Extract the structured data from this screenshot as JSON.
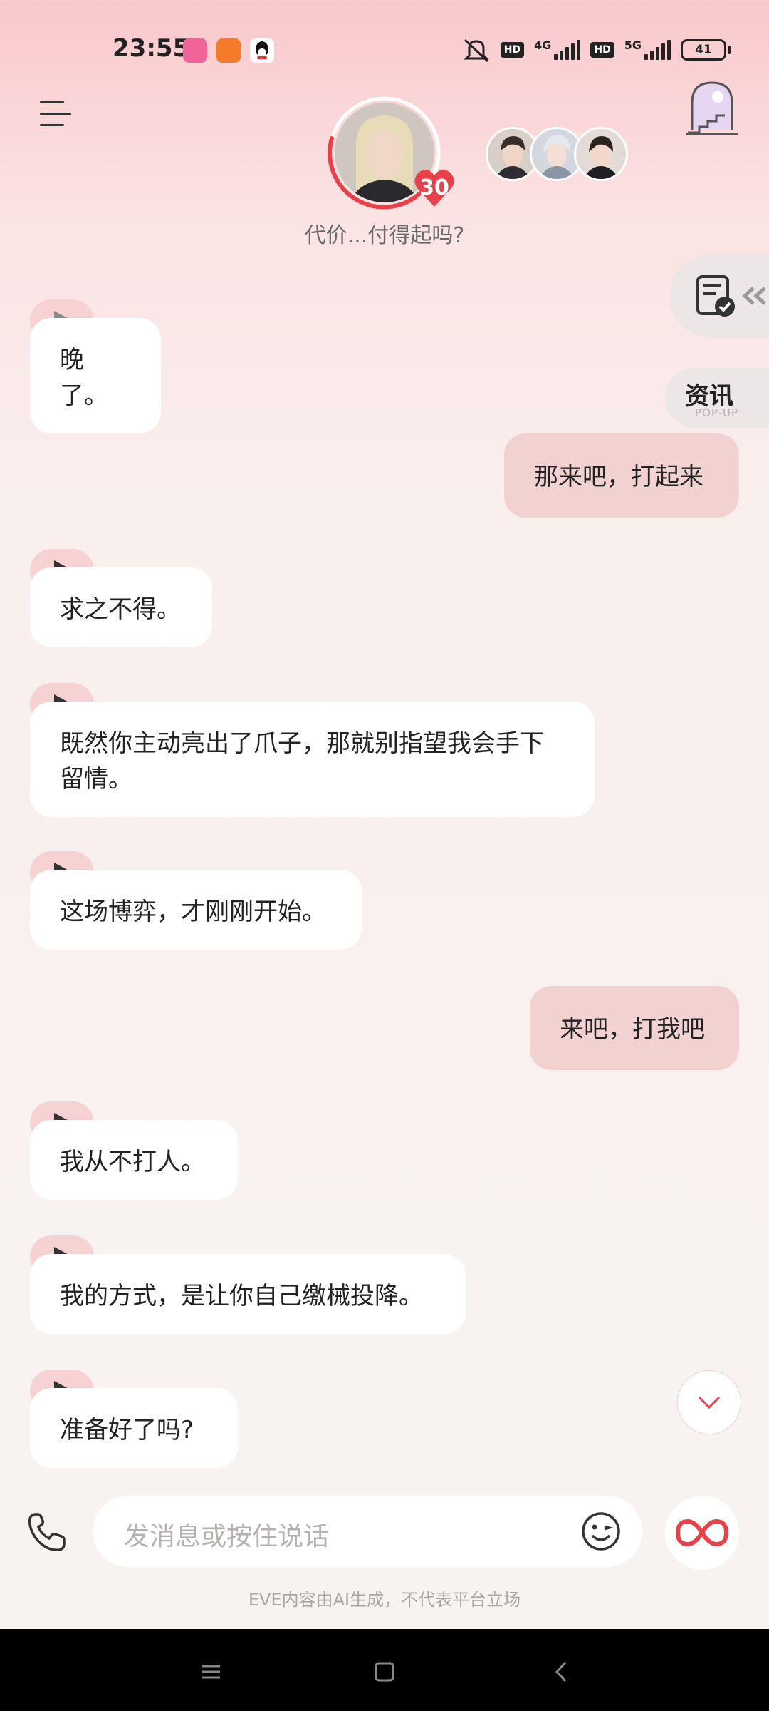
{
  "status_bar": {
    "time": "23:55",
    "network_left": "4G",
    "network_right": "5G",
    "hd_label": "HD",
    "battery": "41"
  },
  "header": {
    "level": "30",
    "subtitle": "代价...付得起吗?"
  },
  "side": {
    "news_title": "资讯",
    "news_subtitle": "POP-UP"
  },
  "messages": [
    {
      "role": "ai",
      "text": "晚了。"
    },
    {
      "role": "user",
      "text": "那来吧，打起来"
    },
    {
      "role": "ai",
      "text": "求之不得。"
    },
    {
      "role": "ai",
      "text": "既然你主动亮出了爪子，那就别指望我会手下留情。"
    },
    {
      "role": "ai",
      "text": "这场博弈，才刚刚开始。"
    },
    {
      "role": "user",
      "text": "来吧，打我吧"
    },
    {
      "role": "ai",
      "text": "我从不打人。"
    },
    {
      "role": "ai",
      "text": "我的方式，是让你自己缴械投降。"
    },
    {
      "role": "ai",
      "text": "准备好了吗?"
    }
  ],
  "input": {
    "placeholder": "发消息或按住说话"
  },
  "disclaimer": "EVE内容由AI生成，不代表平台立场",
  "colors": {
    "accent": "#e8414a",
    "user_bubble": "#f1d2d1",
    "play_tab": "#f7d2d2"
  }
}
